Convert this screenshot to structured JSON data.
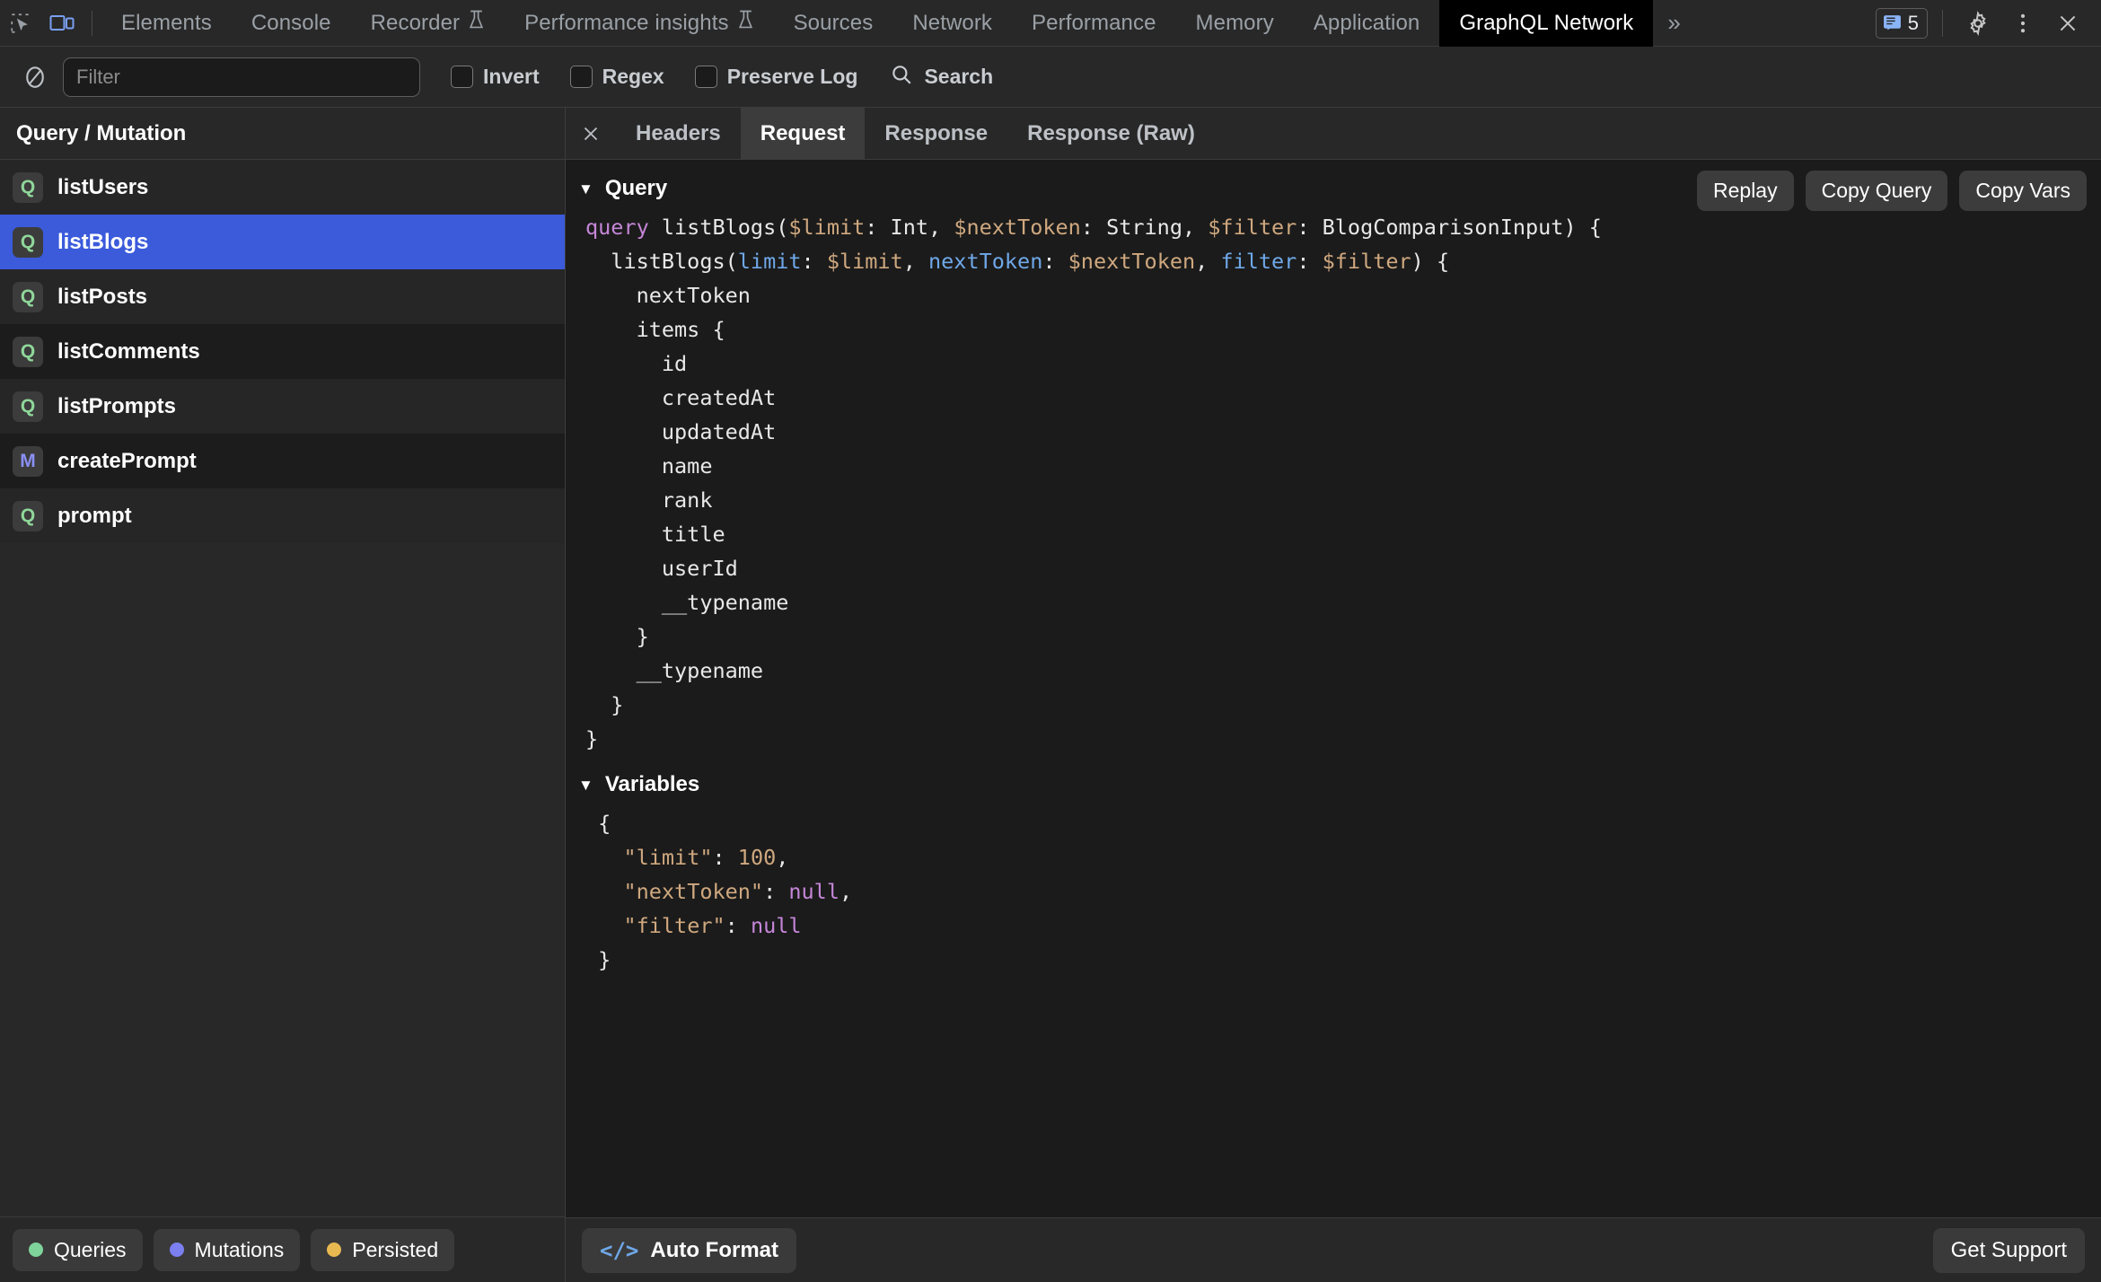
{
  "devtools": {
    "icons": {
      "inspect": "inspect-element-icon",
      "device": "device-toolbar-icon"
    },
    "tabs": [
      {
        "label": "Elements",
        "active": false,
        "flask": false
      },
      {
        "label": "Console",
        "active": false,
        "flask": false
      },
      {
        "label": "Recorder",
        "active": false,
        "flask": true
      },
      {
        "label": "Performance insights",
        "active": false,
        "flask": true
      },
      {
        "label": "Sources",
        "active": false,
        "flask": false
      },
      {
        "label": "Network",
        "active": false,
        "flask": false
      },
      {
        "label": "Performance",
        "active": false,
        "flask": false
      },
      {
        "label": "Memory",
        "active": false,
        "flask": false
      },
      {
        "label": "Application",
        "active": false,
        "flask": false
      },
      {
        "label": "GraphQL Network",
        "active": true,
        "flask": false
      }
    ],
    "overflow_label": "»",
    "message_count": "5",
    "active_tab_bg": "#000000"
  },
  "filterbar": {
    "clear_icon": "clear-icon",
    "filter_placeholder": "Filter",
    "filter_value": "",
    "invert_label": "Invert",
    "regex_label": "Regex",
    "preserve_log_label": "Preserve Log",
    "search_label": "Search"
  },
  "sidebar": {
    "header": "Query / Mutation",
    "items": [
      {
        "badge": "Q",
        "kind": "query",
        "label": "listUsers",
        "selected": false
      },
      {
        "badge": "Q",
        "kind": "query",
        "label": "listBlogs",
        "selected": true
      },
      {
        "badge": "Q",
        "kind": "query",
        "label": "listPosts",
        "selected": false
      },
      {
        "badge": "Q",
        "kind": "query",
        "label": "listComments",
        "selected": false
      },
      {
        "badge": "Q",
        "kind": "query",
        "label": "listPrompts",
        "selected": false
      },
      {
        "badge": "M",
        "kind": "mutation",
        "label": "createPrompt",
        "selected": false
      },
      {
        "badge": "Q",
        "kind": "query",
        "label": "prompt",
        "selected": false
      }
    ],
    "legend": [
      {
        "label": "Queries",
        "color": "#7ed49a"
      },
      {
        "label": "Mutations",
        "color": "#7b7ff0"
      },
      {
        "label": "Persisted",
        "color": "#e8b951"
      }
    ],
    "selected_color": "#3b5bdb"
  },
  "panel": {
    "close_icon": "close-icon",
    "tabs": [
      {
        "label": "Headers",
        "active": false
      },
      {
        "label": "Request",
        "active": true
      },
      {
        "label": "Response",
        "active": false
      },
      {
        "label": "Response (Raw)",
        "active": false
      }
    ],
    "query_section": {
      "title": "Query",
      "expanded": true,
      "buttons": [
        {
          "label": "Replay"
        },
        {
          "label": "Copy Query"
        },
        {
          "label": "Copy Vars"
        }
      ],
      "lines": [
        [
          {
            "t": "query ",
            "c": "kw"
          },
          {
            "t": "listBlogs(",
            "c": "plain"
          },
          {
            "t": "$limit",
            "c": "var"
          },
          {
            "t": ": Int, ",
            "c": "plain"
          },
          {
            "t": "$nextToken",
            "c": "var"
          },
          {
            "t": ": String, ",
            "c": "plain"
          },
          {
            "t": "$filter",
            "c": "var"
          },
          {
            "t": ": BlogComparisonInput) {",
            "c": "plain"
          }
        ],
        [
          {
            "t": "  listBlogs(",
            "c": "plain"
          },
          {
            "t": "limit",
            "c": "arg"
          },
          {
            "t": ": ",
            "c": "plain"
          },
          {
            "t": "$limit",
            "c": "var"
          },
          {
            "t": ", ",
            "c": "plain"
          },
          {
            "t": "nextToken",
            "c": "arg"
          },
          {
            "t": ": ",
            "c": "plain"
          },
          {
            "t": "$nextToken",
            "c": "var"
          },
          {
            "t": ", ",
            "c": "plain"
          },
          {
            "t": "filter",
            "c": "arg"
          },
          {
            "t": ": ",
            "c": "plain"
          },
          {
            "t": "$filter",
            "c": "var"
          },
          {
            "t": ") {",
            "c": "plain"
          }
        ],
        [
          {
            "t": "    nextToken",
            "c": "plain"
          }
        ],
        [
          {
            "t": "    items {",
            "c": "plain"
          }
        ],
        [
          {
            "t": "      id",
            "c": "plain"
          }
        ],
        [
          {
            "t": "      createdAt",
            "c": "plain"
          }
        ],
        [
          {
            "t": "      updatedAt",
            "c": "plain"
          }
        ],
        [
          {
            "t": "      name",
            "c": "plain"
          }
        ],
        [
          {
            "t": "      rank",
            "c": "plain"
          }
        ],
        [
          {
            "t": "      title",
            "c": "plain"
          }
        ],
        [
          {
            "t": "      userId",
            "c": "plain"
          }
        ],
        [
          {
            "t": "      __typename",
            "c": "plain"
          }
        ],
        [
          {
            "t": "    }",
            "c": "plain"
          }
        ],
        [
          {
            "t": "    __typename",
            "c": "plain"
          }
        ],
        [
          {
            "t": "  }",
            "c": "plain"
          }
        ],
        [
          {
            "t": "}",
            "c": "plain"
          }
        ]
      ]
    },
    "variables_section": {
      "title": "Variables",
      "expanded": true,
      "lines": [
        [
          {
            "t": " {",
            "c": "plain"
          }
        ],
        [
          {
            "t": "   ",
            "c": "plain"
          },
          {
            "t": "\"limit\"",
            "c": "key"
          },
          {
            "t": ": ",
            "c": "plain"
          },
          {
            "t": "100",
            "c": "num"
          },
          {
            "t": ",",
            "c": "plain"
          }
        ],
        [
          {
            "t": "   ",
            "c": "plain"
          },
          {
            "t": "\"nextToken\"",
            "c": "key"
          },
          {
            "t": ": ",
            "c": "plain"
          },
          {
            "t": "null",
            "c": "null"
          },
          {
            "t": ",",
            "c": "plain"
          }
        ],
        [
          {
            "t": "   ",
            "c": "plain"
          },
          {
            "t": "\"filter\"",
            "c": "key"
          },
          {
            "t": ": ",
            "c": "plain"
          },
          {
            "t": "null",
            "c": "null"
          }
        ],
        [
          {
            "t": " }",
            "c": "plain"
          }
        ]
      ]
    },
    "footer": {
      "auto_format_label": "Auto Format",
      "auto_format_icon": "code-icon",
      "get_support_label": "Get Support"
    }
  }
}
